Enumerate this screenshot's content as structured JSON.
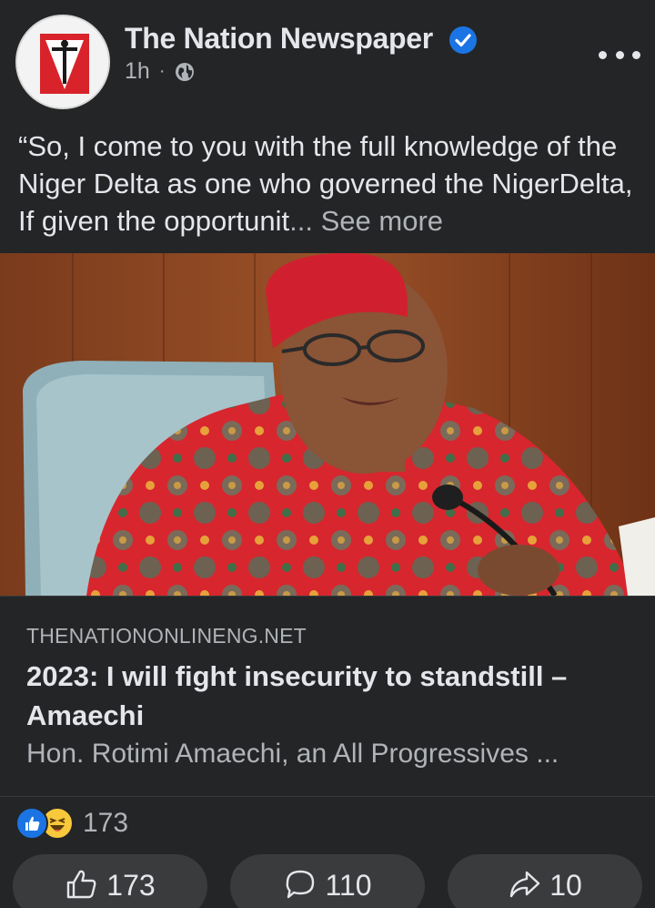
{
  "post": {
    "page_name": "The Nation Newspaper",
    "time": "1h",
    "separator": "·",
    "icons": [
      "verified-badge-icon",
      "globe-icon",
      "more-options-icon"
    ],
    "caption_text": "“So, I come to you with the full knowledge of the Niger Delta as one who governed the NigerDelta, If given the opportunit",
    "caption_ellipsis": "... ",
    "see_more": "See more"
  },
  "link_preview": {
    "domain": "THENATIONONLINENG.NET",
    "headline": "2023: I will fight insecurity to standstill – Amaechi",
    "snippet": "Hon. Rotimi Amaechi, an All Progressives ..."
  },
  "reactions": {
    "types": [
      "like",
      "haha"
    ],
    "count": "173"
  },
  "actions": {
    "like_count": "173",
    "comment_count": "110",
    "share_count": "10"
  },
  "colors": {
    "background": "#242526",
    "text_primary": "#e4e6eb",
    "text_secondary": "#b0b3b8",
    "verified": "#1b74e4",
    "button_bg": "#3a3b3c"
  }
}
